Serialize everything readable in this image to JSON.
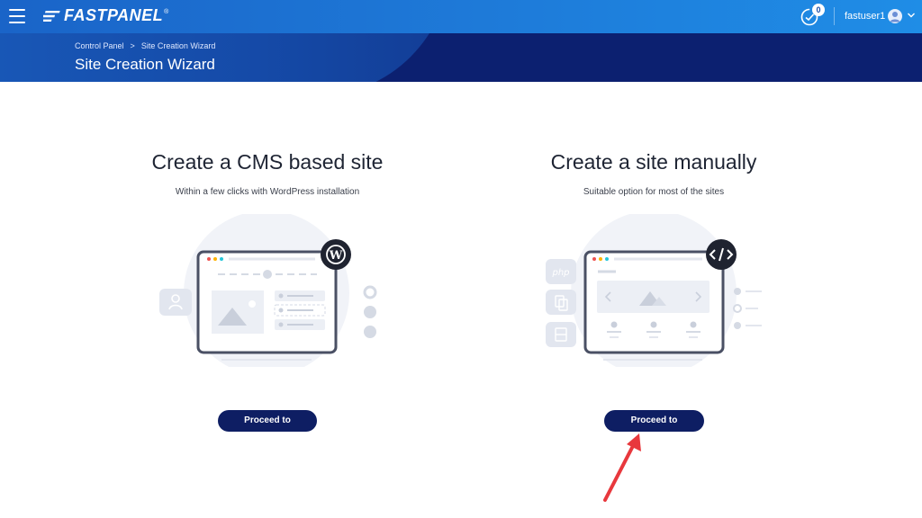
{
  "topbar": {
    "logo": "FASTPANEL",
    "logo_mark": "®",
    "notifications_count": "0",
    "username": "fastuser1"
  },
  "breadcrumb": {
    "items": [
      "Control Panel",
      ">",
      "Site Creation Wizard"
    ]
  },
  "page": {
    "title": "Site Creation Wizard"
  },
  "options": [
    {
      "heading": "Create a CMS based site",
      "description": "Within a few clicks with WordPress installation",
      "button_label": "Proceed to creating",
      "badge_icon": "wordpress-icon"
    },
    {
      "heading": "Create a site manually",
      "description": "Suitable option for most of the sites",
      "button_label": "Proceed to creating",
      "badge_icon": "code-icon",
      "side_label": "php"
    }
  ],
  "colors": {
    "topbar": "#1e7bd9",
    "header_band": "#0c2070",
    "button": "#0e1e63",
    "annotation_arrow": "#e8383d"
  }
}
